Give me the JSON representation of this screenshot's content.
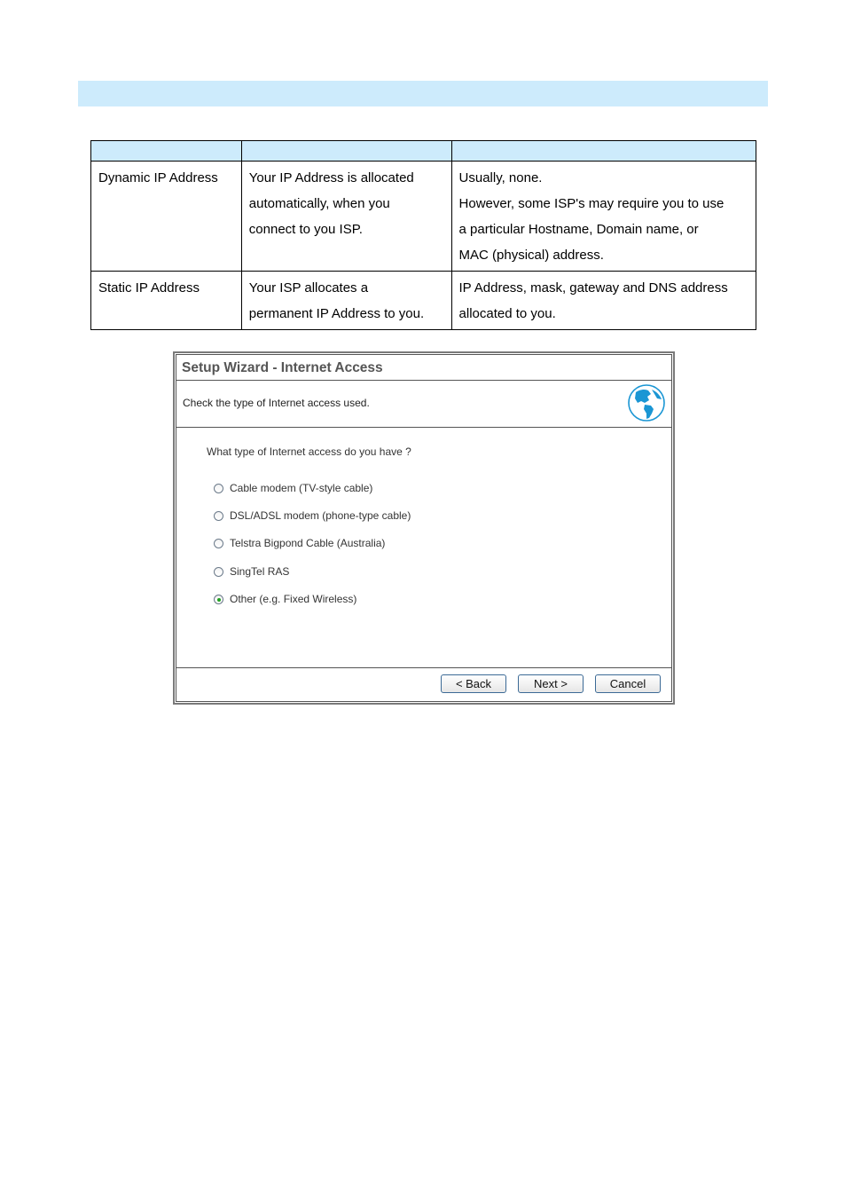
{
  "section_bar": {
    "label": ""
  },
  "table": {
    "headers": [
      "",
      "",
      ""
    ],
    "rows": [
      {
        "type": "Dynamic IP Address",
        "description": [
          "Your IP Address is allocated",
          "automatically, when you",
          "connect to you ISP."
        ],
        "data_required": [
          "Usually, none.",
          "However, some ISP's may require you to use",
          "a particular Hostname, Domain name, or",
          "MAC (physical) address."
        ]
      },
      {
        "type": "Static IP Address",
        "description": [
          "Your ISP allocates a",
          "permanent IP Address to you."
        ],
        "data_required": [
          "IP Address, mask, gateway and DNS address",
          "allocated to you."
        ]
      }
    ]
  },
  "wizard": {
    "title": "Setup Wizard - Internet Access",
    "description": "Check the type of Internet access used.",
    "icon": "globe-icon",
    "question": "What type of Internet access do you have ?",
    "options": [
      {
        "label": "Cable modem (TV-style cable)",
        "checked": false
      },
      {
        "label": "DSL/ADSL modem (phone-type cable)",
        "checked": false
      },
      {
        "label": "Telstra Bigpond Cable (Australia)",
        "checked": false
      },
      {
        "label": "SingTel RAS",
        "checked": false
      },
      {
        "label": "Other (e.g. Fixed Wireless)",
        "checked": true
      }
    ],
    "buttons": {
      "back": "< Back",
      "next": "Next >",
      "cancel": "Cancel"
    }
  },
  "colors": {
    "header_bg": "#cdebfc",
    "globe": "#1a96d4",
    "radio_dot": "#21a121"
  }
}
